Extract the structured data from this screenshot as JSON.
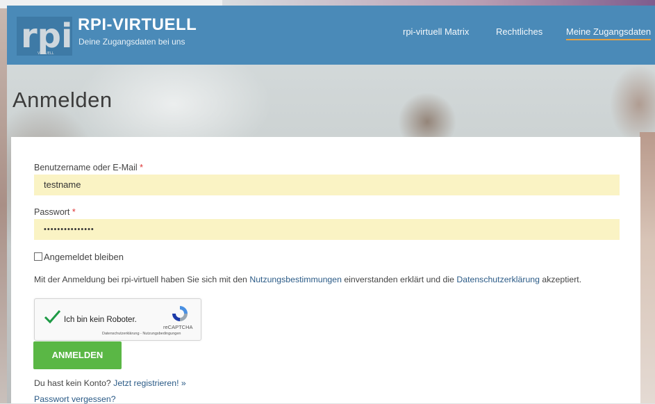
{
  "header": {
    "logo_text": "rpi",
    "logo_small": "VIRTUELL",
    "title": "RPI-VIRTUELL",
    "subtitle": "Deine Zugangsdaten bei uns",
    "nav": [
      {
        "label": "rpi-virtuell Matrix"
      },
      {
        "label": "Rechtliches"
      },
      {
        "label": "Meine Zugangsdaten"
      }
    ],
    "brand_color": "#4a8ab8",
    "active_underline_color": "#e5a042"
  },
  "page": {
    "title": "Anmelden"
  },
  "form": {
    "username_label": "Benutzername oder E-Mail",
    "username_value": "testname",
    "password_label": "Passwort",
    "password_value": "•••••••••••••••",
    "required_mark": "*",
    "remember_label": "Angemeldet bleiben",
    "consent_prefix": "Mit der Anmeldung bei rpi-virtuell haben Sie sich mit den ",
    "consent_link1": "Nutzungsbestimmungen",
    "consent_middle": " einverstanden erklärt und die ",
    "consent_link2": "Datenschutzerklärung",
    "consent_suffix": " akzeptiert.",
    "captcha_label": "Ich bin kein Roboter.",
    "captcha_brand": "reCAPTCHA",
    "captcha_links": "Datenschutzerklärung - Nutzungsbedingungen",
    "submit_label": "ANMELDEN",
    "register_prefix": "Du hast kein Konto? ",
    "register_link": "Jetzt registrieren! »",
    "forgot_link": "Passwort vergessen?",
    "field_color": "#faf3c4",
    "button_color": "#5ab745"
  }
}
